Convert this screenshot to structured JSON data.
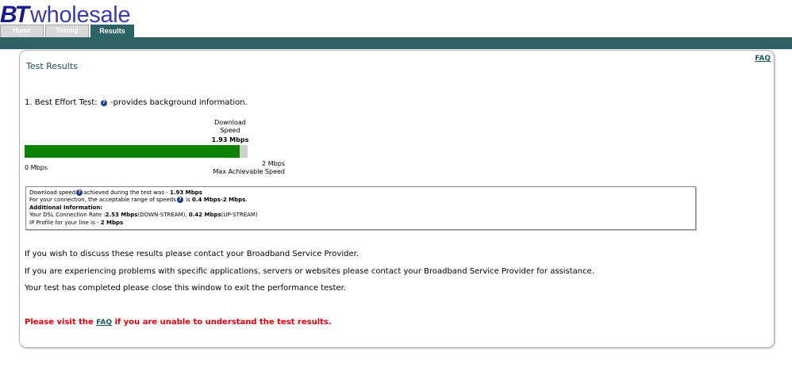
{
  "header": {
    "logo_bt": "BT",
    "logo_wholesale": "wholesale",
    "tabs": [
      {
        "label": "Home"
      },
      {
        "label": "Testing"
      },
      {
        "label": "Results"
      }
    ]
  },
  "page": {
    "faq_link": "FAQ",
    "title": "Test Results"
  },
  "test": {
    "label": "1. Best Effort Test:",
    "note": "-provides background information.",
    "download_label": "Download Speed",
    "download_value": "1.93 Mbps",
    "bar_min": "0 Mbps",
    "bar_max": "2 Mbps",
    "bar_max_label": "Max Achievable Speed",
    "bar_fill_fraction": 0.965
  },
  "info": {
    "line1_a": "Download speed",
    "line1_b": "achieved during the test was - ",
    "line1_value": "1.93 Mbps",
    "line2_a": "For your connection, the acceptable range of speeds",
    "line2_b": " is ",
    "line2_value": "0.4 Mbps-2 Mbps",
    "line2_end": ".",
    "line3": "Additional Information:",
    "line4_a": "Your DSL Connection Rate :",
    "line4_down": "2.53 Mbps",
    "line4_down_label": "(DOWN-STREAM), ",
    "line4_up": "0.42 Mbps",
    "line4_up_label": "(UP-STREAM)",
    "line5_a": "IP Profile for your line is - ",
    "line5_value": "2 Mbps"
  },
  "messages": {
    "m1": "If you wish to discuss these results please contact your Broadband Service Provider.",
    "m2": "If you are experiencing problems with specific applications, servers or websites please contact your Broadband Service Provider for assistance.",
    "m3": "Your test has completed please close this window to exit the performance tester.",
    "warn_a": "Please visit the ",
    "warn_link": "FAQ",
    "warn_b": " if you are unable to understand the test results."
  },
  "colors": {
    "accent": "#2d6163",
    "bar_fill": "#0a8400",
    "warning": "#e0000a"
  }
}
